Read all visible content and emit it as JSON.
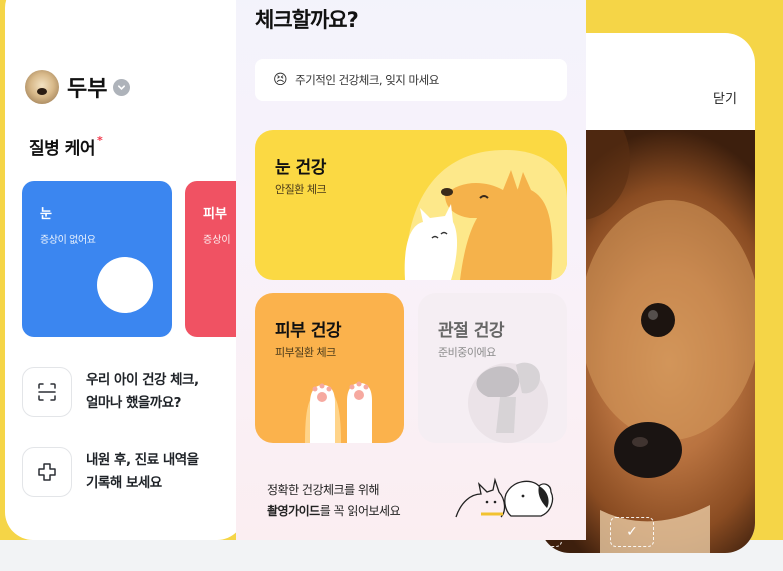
{
  "left_screen": {
    "pet_name": "두부",
    "section_title": "질병 케어",
    "required_mark": "*",
    "cards": [
      {
        "title": "눈",
        "subtitle": "증상이 없어요",
        "emoji": "😍",
        "color": "#3b86f0"
      },
      {
        "title": "피부",
        "subtitle": "증상이",
        "color": "#f05263"
      }
    ],
    "rows": [
      {
        "line1": "우리 아이 건강 체크,",
        "line2": "얼마나 했을까요?",
        "icon": "scan-icon"
      },
      {
        "line1": "내원 후, 진료 내역을",
        "line2": "기록해 보세요",
        "icon": "hospital-cross-icon"
      }
    ]
  },
  "center_screen": {
    "heading": "체크할까요?",
    "notice_emoji": "😣",
    "notice_text": "주기적인 건강체크, 잊지 마세요",
    "cards": [
      {
        "title": "눈 건강",
        "subtitle": "안질환 체크",
        "color": "#fbd943"
      },
      {
        "title": "피부 건강",
        "subtitle": "피부질환 체크",
        "color": "#fbb24c"
      },
      {
        "title": "관절 건강",
        "subtitle": "준비중이에요",
        "color": "#f5eef3"
      }
    ],
    "footer_line1": "정확한 건강체크를 위해",
    "footer_bold": "촬영가이드",
    "footer_rest": "를 꼭 읽어보세요"
  },
  "right_screen": {
    "close_label": "닫기",
    "frame_check": "✓"
  },
  "colors": {
    "background": "#f5d547",
    "accent_blue": "#3b86f0",
    "accent_red": "#f05263"
  }
}
